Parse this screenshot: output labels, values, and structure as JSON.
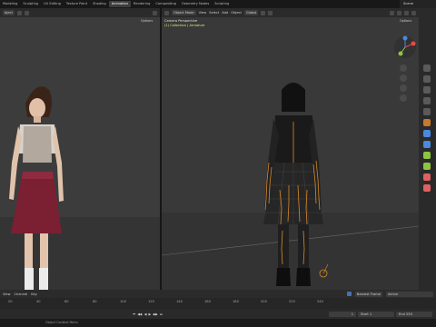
{
  "topbar": {
    "tabs": [
      "Modeling",
      "Sculpting",
      "UV Editing",
      "Texture Paint",
      "Shading",
      "Animation",
      "Rendering",
      "Compositing",
      "Geometry Nodes",
      "Scripting"
    ],
    "active_tab": "Animation",
    "scene": "Scene"
  },
  "left_header": {
    "mode": "bject",
    "options": "Options"
  },
  "right_header": {
    "mode": "Object Mode",
    "menus": [
      "View",
      "Select",
      "Add",
      "Object"
    ],
    "orientation": "Global",
    "options": "Options"
  },
  "viewport": {
    "camera_title": "Camera Perspective",
    "camera_sub": "(1) Collection | Armature"
  },
  "timeline": {
    "menus": [
      "View",
      "Channel",
      "Key"
    ],
    "keying": "Active",
    "keying_label": "Nearest Frame",
    "ruler": [
      "20",
      "40",
      "60",
      "80",
      "100",
      "120",
      "140",
      "160",
      "180",
      "200",
      "220",
      "240"
    ]
  },
  "playback": {
    "current_frame": "1",
    "start_label": "Start",
    "start_value": "1",
    "end_label": "End",
    "end_value": "250"
  },
  "status": {
    "text": "Object Context Menu"
  },
  "colors": {
    "accent": "#4772b3",
    "highlight": "#e6e67a",
    "x_axis": "#e04b4b",
    "y_axis": "#8dc540",
    "z_axis": "#4a89e0",
    "bone_orange": "#d88a2a"
  }
}
